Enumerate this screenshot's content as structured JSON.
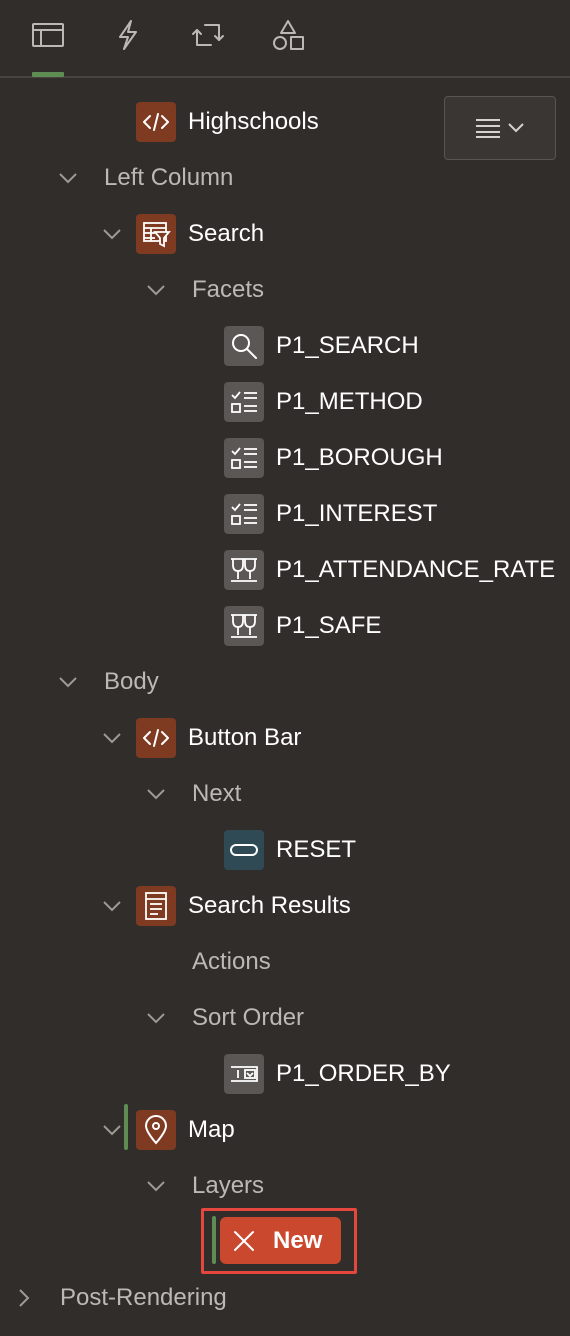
{
  "tabs": [
    {
      "icon": "rendering-tree-icon",
      "active": true
    },
    {
      "icon": "dynamic-actions-icon",
      "active": false
    },
    {
      "icon": "processing-icon",
      "active": false
    },
    {
      "icon": "shared-components-icon",
      "active": false
    }
  ],
  "tree": {
    "highschools": "Highschools",
    "left_column": "Left Column",
    "search": "Search",
    "facets": "Facets",
    "p1_search": "P1_SEARCH",
    "p1_method": "P1_METHOD",
    "p1_borough": "P1_BOROUGH",
    "p1_interest": "P1_INTEREST",
    "p1_attendance_rate": "P1_ATTENDANCE_RATE",
    "p1_safe": "P1_SAFE",
    "body": "Body",
    "button_bar": "Button Bar",
    "next": "Next",
    "reset": "RESET",
    "search_results": "Search Results",
    "actions": "Actions",
    "sort_order": "Sort Order",
    "p1_order_by": "P1_ORDER_BY",
    "map": "Map",
    "layers": "Layers",
    "new_layer": "New",
    "post_rendering": "Post-Rendering"
  },
  "colors": {
    "background": "#312d2a",
    "region_icon": "#7e3b22",
    "item_icon": "#5b5754",
    "button_icon": "#2f4a55",
    "selection_accent": "#5f8c55",
    "new_button": "#c9482e",
    "highlight_outline": "#e5473e"
  }
}
